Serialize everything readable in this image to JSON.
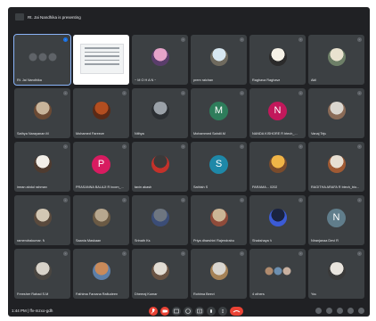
{
  "topbar": {
    "presenting_text": "Rt. Jai Nandhika is presenting"
  },
  "tiles": [
    {
      "name": "Rt. Jai Nandhika",
      "kind": "self",
      "mic_active": true
    },
    {
      "name": "",
      "kind": "screen"
    },
    {
      "name": "~ M O H A N ~",
      "kind": "photo",
      "colors": [
        "#e6a3c9",
        "#5a3d6b"
      ]
    },
    {
      "name": "prem raichan",
      "kind": "photo",
      "colors": [
        "#d7e7f0",
        "#6f6a5e"
      ]
    },
    {
      "name": "Raghava Raghava",
      "kind": "photo",
      "colors": [
        "#f5f1e6",
        "#2b2b2b"
      ]
    },
    {
      "name": "Akil",
      "kind": "photo",
      "colors": [
        "#e9e2cf",
        "#6d7f67"
      ]
    },
    {
      "name": "Sathya Narayanan M",
      "kind": "photo",
      "colors": [
        "#c8b49a",
        "#6b4a34"
      ]
    },
    {
      "name": "Mohamed Fareeze",
      "kind": "photo",
      "colors": [
        "#b34e20",
        "#5b2a16"
      ]
    },
    {
      "name": "Nithya",
      "kind": "photo",
      "colors": [
        "#9aa1a8",
        "#2b2f33"
      ]
    },
    {
      "name": "Mohammed Sahdil.M",
      "kind": "letter",
      "letter": "M",
      "bg": "#2e7d5b"
    },
    {
      "name": "NANDA KISHORE R btech_...",
      "kind": "letter",
      "letter": "N",
      "bg": "#c2185b"
    },
    {
      "name": "Vanaj Teju",
      "kind": "photo",
      "colors": [
        "#dad6cf",
        "#8a6b57"
      ]
    },
    {
      "name": "imran abdul rahman",
      "kind": "photo",
      "colors": [
        "#f3efe9",
        "#4e3b30"
      ]
    },
    {
      "name": "PRASANNA BALAJI R bcom_...",
      "kind": "letter",
      "letter": "P",
      "bg": "#d81b60"
    },
    {
      "name": "tavin akash",
      "kind": "photo",
      "colors": [
        "#3a3a3a",
        "#c4312a"
      ]
    },
    {
      "name": "Sathish S",
      "kind": "letter",
      "letter": "S",
      "bg": "#1e88a8"
    },
    {
      "name": "PARAMA... 0202",
      "kind": "photo",
      "colors": [
        "#f0b547",
        "#7a4b2b"
      ]
    },
    {
      "name": "RAGITHA ARAFA R btech_bio...",
      "kind": "photo",
      "colors": [
        "#e7dfd2",
        "#a05a33"
      ]
    },
    {
      "name": "ramendrakumar. N",
      "kind": "photo",
      "colors": [
        "#d2c7b4",
        "#5a4a3d"
      ]
    },
    {
      "name": "Saania Maskaan",
      "kind": "photo",
      "colors": [
        "#b7a78e",
        "#6b5a44"
      ]
    },
    {
      "name": "Srinath Ks",
      "kind": "photo",
      "colors": [
        "#6e7680",
        "#3b4d77"
      ]
    },
    {
      "name": "Priya dharshini Rajendrabu",
      "kind": "photo",
      "colors": [
        "#cbb595",
        "#8f4b3a"
      ]
    },
    {
      "name": "Shakshaya V",
      "kind": "photo",
      "colors": [
        "#1a2340",
        "#3b5bd6"
      ]
    },
    {
      "name": "Niranjanaa Devi R",
      "kind": "letter",
      "letter": "N",
      "bg": "#607d8b"
    },
    {
      "name": "Freesher Rahad S.M",
      "kind": "photo",
      "colors": [
        "#d8d3ca",
        "#4a4641"
      ]
    },
    {
      "name": "Fathima Farzana Rafiudeen",
      "kind": "photo",
      "colors": [
        "#c98a5a",
        "#5d7fa8"
      ]
    },
    {
      "name": "Dheeraj Kumar",
      "kind": "photo",
      "colors": [
        "#e1dcd3",
        "#6a5444"
      ]
    },
    {
      "name": "Rohima Beevi",
      "kind": "photo",
      "colors": [
        "#d8d5cf",
        "#a58257"
      ]
    },
    {
      "name": "4 others",
      "kind": "multi"
    },
    {
      "name": "You",
      "kind": "photo",
      "colors": [
        "#e9e5de",
        "#3a3a3a"
      ]
    }
  ],
  "bottombar": {
    "time_text": "1:44 PM  |  ffv-mzxo-gdh"
  }
}
